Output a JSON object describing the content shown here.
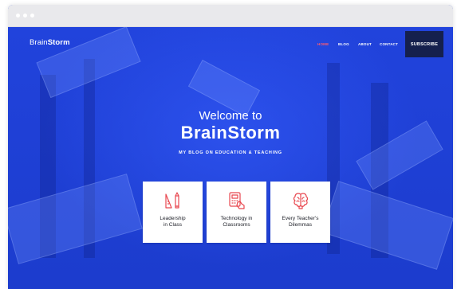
{
  "brand": {
    "prefix": "Brain",
    "bold": "Storm"
  },
  "nav": {
    "items": [
      {
        "label": "HOME",
        "active": true
      },
      {
        "label": "BLOG",
        "active": false
      },
      {
        "label": "ABOUT",
        "active": false
      },
      {
        "label": "CONTACT",
        "active": false
      }
    ],
    "subscribe_label": "SUBSCRIBE"
  },
  "hero": {
    "welcome": "Welcome to",
    "title": "BrainStorm",
    "subtitle": "MY BLOG ON EDUCATION & TEACHING"
  },
  "cards": [
    {
      "icon": "ruler-pencil-icon",
      "line1": "Leadership",
      "line2": "in Class"
    },
    {
      "icon": "tablet-hand-icon",
      "line1": "Technology in",
      "line2": "Classrooms"
    },
    {
      "icon": "brain-icon",
      "line1": "Every Teacher's",
      "line2": "Dilemmas"
    }
  ],
  "colors": {
    "hero_blue": "#1f3fd8",
    "accent_red": "#ff5b6e",
    "icon_red": "#e8474f",
    "subscribe_bg": "#15204d"
  }
}
